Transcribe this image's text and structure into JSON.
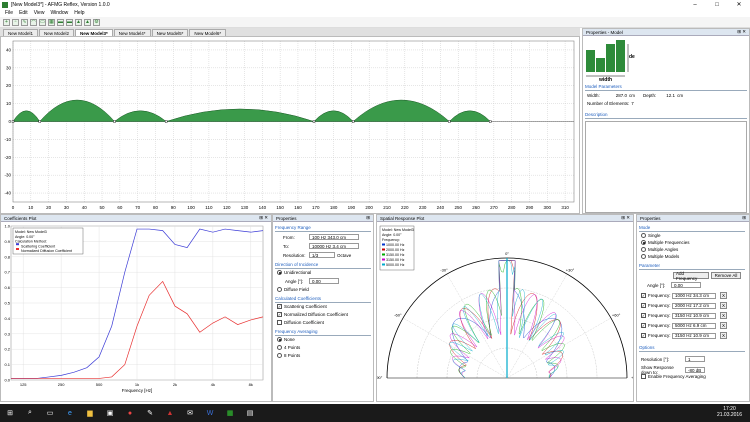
{
  "window": {
    "title": "[New Model3*] - AFMG Reflex, Version 1.0.0",
    "minimize": "–",
    "maximize": "□",
    "close": "✕"
  },
  "menu": [
    "File",
    "Edit",
    "View",
    "Window",
    "Help"
  ],
  "tabs": [
    "New Model1",
    "New Model2",
    "New Model3*",
    "New Model4*",
    "New Model5*",
    "New Model6*"
  ],
  "active_tab": 2,
  "main_plot": {
    "x_ticks": [
      "0",
      "10",
      "20",
      "30",
      "40",
      "50",
      "60",
      "70",
      "80",
      "90",
      "100",
      "110",
      "120",
      "130",
      "140",
      "150",
      "160",
      "170",
      "180",
      "190",
      "200",
      "210",
      "220",
      "230",
      "240",
      "250",
      "260",
      "270",
      "280",
      "290",
      "300",
      "310"
    ],
    "y_ticks": [
      "40",
      "30",
      "20",
      "10",
      "0",
      "-10",
      "-20",
      "-30",
      "-40"
    ]
  },
  "props_model": {
    "title": "Properties - Model",
    "width_label": "width",
    "depth_label": "depth",
    "section": "Model Parameters",
    "width_key": "Width:",
    "width_val": "287.0",
    "width_unit": "cm",
    "depth_key": "Depth:",
    "depth_val": "12.1",
    "depth_unit": "cm",
    "elements_key": "Number of Elements:",
    "elements_val": "7",
    "description": "Description"
  },
  "coef_plot": {
    "title": "Coefficients Plot",
    "legend": [
      "Model:    New Model3",
      "Angle:    0.00°",
      "Calculation Method:",
      "Scattering Coefficient",
      "Normalized Diffusion Coefficient"
    ],
    "y_ticks": [
      "1.0",
      "0.9",
      "0.8",
      "0.7",
      "0.6",
      "0.5",
      "0.4",
      "0.3",
      "0.2",
      "0.1",
      "0.0"
    ],
    "x_ticks": [
      "125",
      "250",
      "500",
      "1k",
      "2k",
      "4k",
      "8k"
    ],
    "xlabel": "Frequency [Hz]",
    "colors": {
      "scattering": "#3b3bd6",
      "diffusion": "#e83030"
    }
  },
  "chart_data": {
    "type": "line",
    "title": "",
    "xlabel": "Frequency [Hz]",
    "ylabel": "",
    "ylim": [
      0,
      1
    ],
    "x": [
      100,
      125,
      160,
      200,
      250,
      315,
      400,
      500,
      630,
      800,
      1000,
      1250,
      1600,
      2000,
      2500,
      3150,
      4000,
      5000,
      6300,
      8000,
      10000
    ],
    "series": [
      {
        "name": "Scattering Coefficient",
        "values": [
          0.01,
          0.01,
          0.01,
          0.02,
          0.03,
          0.05,
          0.08,
          0.15,
          0.35,
          0.7,
          0.98,
          0.98,
          0.97,
          0.88,
          0.86,
          0.98,
          0.96,
          0.98,
          0.97,
          0.96,
          0.97
        ]
      },
      {
        "name": "Normalized Diffusion Coefficient",
        "values": [
          0.01,
          0.01,
          0.01,
          0.01,
          0.01,
          0.01,
          0.01,
          0.01,
          0.02,
          0.1,
          0.35,
          0.55,
          0.64,
          0.48,
          0.43,
          0.31,
          0.37,
          0.41,
          0.36,
          0.39,
          0.41
        ]
      }
    ]
  },
  "props_freq": {
    "title": "Properties",
    "freq_range": "Frequency Range",
    "from_label": "From:",
    "from_val": "100 Hz   343.0 cm",
    "to_label": "To:",
    "to_val": "10000 Hz   3.4 cm",
    "res_label": "Resolution:",
    "res_val": "1/3",
    "res_unit": "Octave",
    "dir_title": "Direction of Incidence",
    "unidirectional": "Unidirectional",
    "angle_label": "Angle [°]:",
    "angle_val": "0.00",
    "diffuse": "Diffuse Field",
    "calc_title": "Calculated Coefficients",
    "scattering": "Scattering Coefficient",
    "norm_diff": "Normalized Diffusion Coefficient",
    "diffusion": "Diffusion Coefficient",
    "avg_title": "Frequency Averaging",
    "none": "None",
    "four": "4 Points",
    "eight": "8 Points"
  },
  "spatial": {
    "title": "Spatial Response Plot",
    "legend": [
      "Model:   New Model3",
      "Angle:   0.00°",
      "Frequency:",
      "1000.00 Hz",
      "2000.00 Hz",
      "3150.00 Hz",
      "3150.00 Hz",
      "5000.00 Hz"
    ],
    "legend_colors": [
      "#0033cc",
      "#cc0000",
      "#00aa00",
      "#cc00cc",
      "#00aacc"
    ],
    "angle_labels": [
      "0°",
      "+30°",
      "+60°",
      "-30°",
      "-60°",
      "+90°",
      "-90°"
    ]
  },
  "props_spatial": {
    "title": "Properties",
    "mode_title": "Mode",
    "single": "Single",
    "multi_freq": "Multiple Frequencies",
    "multi_angles": "Multiple Angles",
    "multi_models": "Multiple Models",
    "param_title": "Parameter",
    "add_freq": "Add Frequency",
    "remove_all": "Remove All",
    "angle_label": "Angle [°]:",
    "angle_val": "0.00",
    "freq_label": "Frequency:",
    "freqs": [
      "1000 Hz   34.3 cm",
      "2000 Hz   17.2 cm",
      "3150 Hz   10.9 cm",
      "5000 Hz   6.9 cm",
      "3150 Hz   10.9 cm"
    ],
    "options_title": "Options",
    "resolution_label": "Resolution [°]:",
    "resolution_val": "1",
    "show_resp_label": "Show Response down to:",
    "show_resp_val": "-80 dB",
    "enable_avg": "Enable Frequency Averaging",
    "x_btn": "X"
  },
  "taskbar": {
    "time": "17:20",
    "date": "21.03.2016"
  }
}
